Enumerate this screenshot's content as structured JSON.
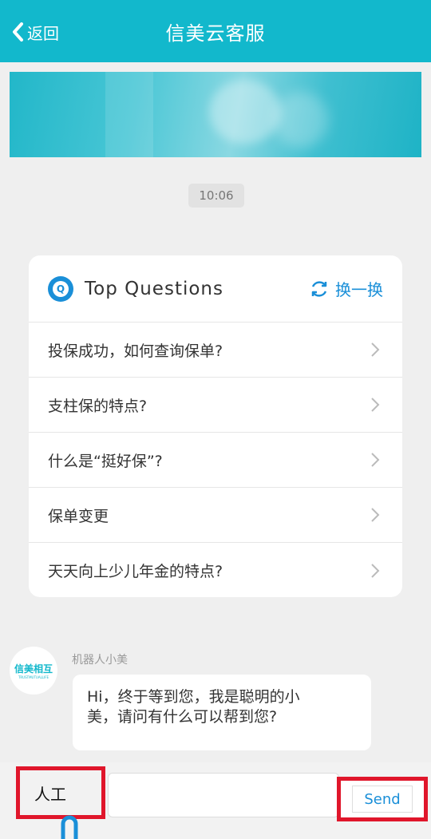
{
  "header": {
    "back_label": "返回",
    "title": "信美云客服"
  },
  "chat": {
    "timestamp": "10:06"
  },
  "questions_card": {
    "title": "Top Questions",
    "refresh_label": "换一换",
    "items": [
      {
        "label": "投保成功，如何查询保单?"
      },
      {
        "label": "支柱保的特点?"
      },
      {
        "label": "什么是“挺好保”?"
      },
      {
        "label": "保单变更"
      },
      {
        "label": "天天向上少儿年金的特点?"
      }
    ]
  },
  "bot": {
    "name": "机器人小美",
    "logo_cn": "信美相互",
    "logo_en": "TRUSTMUTUALLIFE",
    "message_line1": "Hi，终于等到您，我是聪明的小",
    "message_line2": "美，请问有什么可以帮到您?"
  },
  "input": {
    "human_label": "人工",
    "send_label": "Send",
    "value": ""
  },
  "colors": {
    "primary": "#12b8cc",
    "accent": "#1a8fd8",
    "highlight": "#e0162b"
  },
  "icons": [
    "chevron-left-icon",
    "question-icon",
    "refresh-icon",
    "chevron-right-icon",
    "mic-icon"
  ]
}
